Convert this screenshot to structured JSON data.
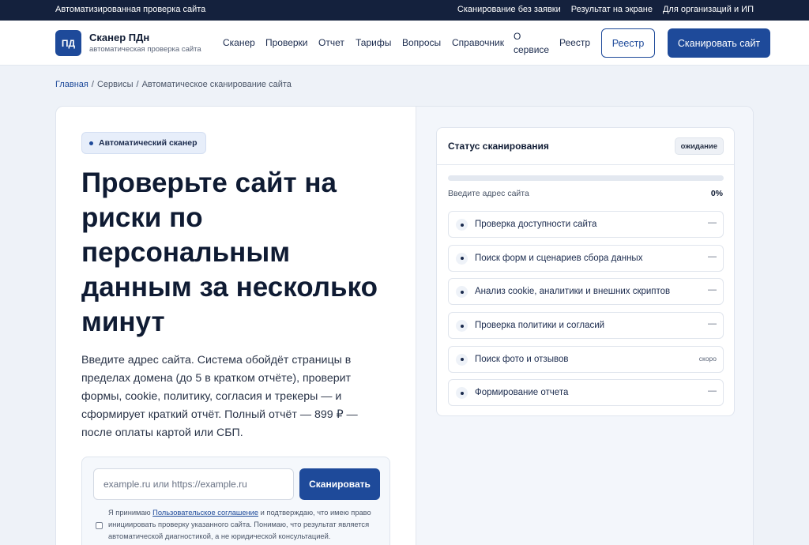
{
  "topbar": {
    "tagline": "Автоматизированная проверка сайта",
    "links": [
      "Сканирование без заявки",
      "Результат на экране",
      "Для организаций и ИП"
    ]
  },
  "header": {
    "logo_text": "ПД",
    "brand_name": "Сканер ПДн",
    "brand_sub": "автоматическая проверка сайта",
    "nav": [
      "Сканер",
      "Проверки",
      "Отчет",
      "Тарифы",
      "Вопросы",
      "Справочник",
      "О",
      "сервисе",
      "Реестр"
    ],
    "registry_button": "Реестр",
    "scan_button": "Сканировать сайт"
  },
  "breadcrumb": {
    "home": "Главная",
    "services": "Сервисы",
    "current": "Автоматическое сканирование сайта",
    "separator": "/"
  },
  "hero": {
    "pill": "Автоматический сканер",
    "title": "Проверьте сайт на риски по персональным данным за несколько минут",
    "description": "Введите адрес сайта. Система обойдёт страницы в пределах домена (до 5 в кратком отчёте), проверит формы, cookie, политику, согласия и трекеры — и сформирует краткий отчёт. Полный отчёт — 899 ₽ — после оплаты картой или СБП."
  },
  "form": {
    "placeholder": "example.ru или https://example.ru",
    "value": "",
    "submit": "Сканировать",
    "consent_before": "Я принимаю ",
    "consent_link": "Пользовательское соглашение",
    "consent_after": " и подтверждаю, что имею право инициировать проверку указанного сайта. Понимаю, что результат является автоматической диагностикой, а не юридической консультацией.",
    "consent_checked": false
  },
  "status": {
    "title": "Статус сканирования",
    "badge": "ожидание",
    "progress_label": "Введите адрес сайта",
    "progress_percent": 0,
    "progress_text": "0%",
    "steps": [
      {
        "label": "Проверка доступности сайта",
        "state": "—"
      },
      {
        "label": "Поиск форм и сценариев сбора данных",
        "state": "—"
      },
      {
        "label": "Анализ cookie, аналитики и внешних скриптов",
        "state": "—"
      },
      {
        "label": "Проверка политики и согласий",
        "state": "—"
      },
      {
        "label": "Поиск фото и отзывов",
        "state": "скоро"
      },
      {
        "label": "Формирование отчета",
        "state": "—"
      }
    ]
  },
  "colors": {
    "primary": "#1e4a9a",
    "topbar": "#14213d",
    "page_bg": "#eef2f8"
  }
}
